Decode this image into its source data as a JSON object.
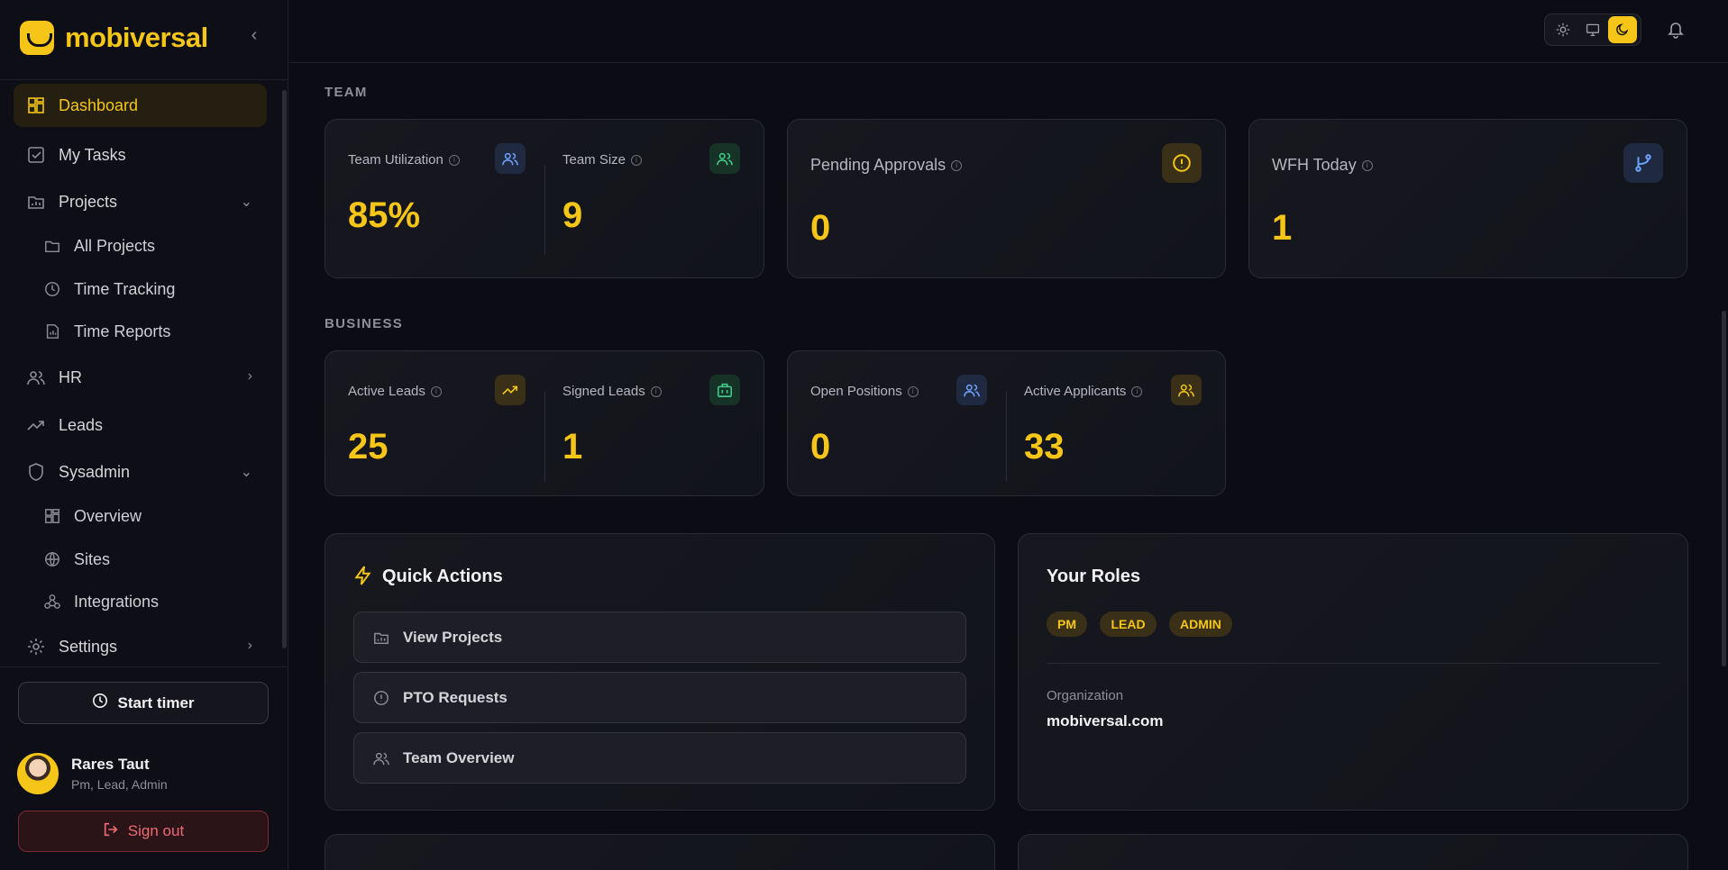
{
  "brand": {
    "name": "mobiversal"
  },
  "sidebar": {
    "items": [
      {
        "label": "Dashboard"
      },
      {
        "label": "My Tasks"
      },
      {
        "label": "Projects"
      },
      {
        "label": "All Projects"
      },
      {
        "label": "Time Tracking"
      },
      {
        "label": "Time Reports"
      },
      {
        "label": "HR"
      },
      {
        "label": "Leads"
      },
      {
        "label": "Sysadmin"
      },
      {
        "label": "Overview"
      },
      {
        "label": "Sites"
      },
      {
        "label": "Integrations"
      },
      {
        "label": "Settings"
      }
    ],
    "start_timer_label": "Start timer",
    "user": {
      "name": "Rares Taut",
      "roles": "Pm, Lead, Admin"
    },
    "sign_out_label": "Sign out"
  },
  "sections": {
    "team": "TEAM",
    "business": "BUSINESS"
  },
  "team": {
    "utilization": {
      "label": "Team Utilization",
      "value": "85%"
    },
    "size": {
      "label": "Team Size",
      "value": "9"
    },
    "pending": {
      "label": "Pending Approvals",
      "value": "0"
    },
    "wfh": {
      "label": "WFH Today",
      "value": "1"
    }
  },
  "business": {
    "active_leads": {
      "label": "Active Leads",
      "value": "25"
    },
    "signed_leads": {
      "label": "Signed Leads",
      "value": "1"
    },
    "open_positions": {
      "label": "Open Positions",
      "value": "0"
    },
    "active_applicants": {
      "label": "Active Applicants",
      "value": "33"
    }
  },
  "quick_actions": {
    "title": "Quick Actions",
    "items": [
      {
        "label": "View Projects"
      },
      {
        "label": "PTO Requests"
      },
      {
        "label": "Team Overview"
      }
    ]
  },
  "roles": {
    "title": "Your Roles",
    "pills": [
      "PM",
      "LEAD",
      "ADMIN"
    ],
    "org_label": "Organization",
    "org_value": "mobiversal.com"
  },
  "colors": {
    "accent": "#f5c518",
    "background": "#0c0d14"
  }
}
